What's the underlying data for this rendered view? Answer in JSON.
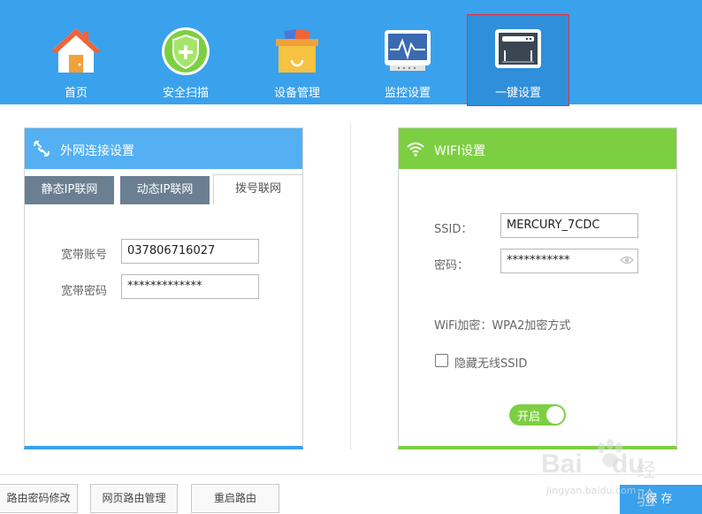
{
  "nav": {
    "items": [
      {
        "label": "首页",
        "icon": "home-icon"
      },
      {
        "label": "安全扫描",
        "icon": "shield-icon"
      },
      {
        "label": "设备管理",
        "icon": "device-box-icon"
      },
      {
        "label": "监控设置",
        "icon": "monitor-icon"
      },
      {
        "label": "一键设置",
        "icon": "router-icon"
      }
    ],
    "active_index": 4
  },
  "wan": {
    "title": "外网连接设置",
    "icon": "link-icon",
    "tabs": [
      {
        "label": "静态IP联网"
      },
      {
        "label": "动态IP联网"
      },
      {
        "label": "拨号联网"
      }
    ],
    "active_tab": 2,
    "account_label": "宽带账号",
    "account_value": "037806716027",
    "password_label": "宽带密码",
    "password_value": "*************"
  },
  "wifi": {
    "title": "WIFI设置",
    "icon": "wifi-icon",
    "ssid_label": "SSID：",
    "ssid_value": "MERCURY_7CDC",
    "password_label": "密码：",
    "password_value": "***********",
    "encryption_text": "WiFi加密：WPA2加密方式",
    "hide_ssid_label": "隐藏无线SSID",
    "hide_ssid_checked": false,
    "toggle_label": "开启",
    "toggle_on": true
  },
  "bottom": {
    "buttons": [
      {
        "label": "路由密码修改"
      },
      {
        "label": "网页路由管理"
      },
      {
        "label": "重启路由"
      }
    ],
    "save_label": "保存"
  },
  "watermark": {
    "brand": "Bai",
    "brand2": "du",
    "jingyan": "经验",
    "url": "jingyan.baidu.com"
  },
  "colors": {
    "topbar": "#3aa1ec",
    "wan_header": "#54b0f2",
    "wifi_header": "#7dcf42",
    "active_outline": "#e8303b"
  }
}
